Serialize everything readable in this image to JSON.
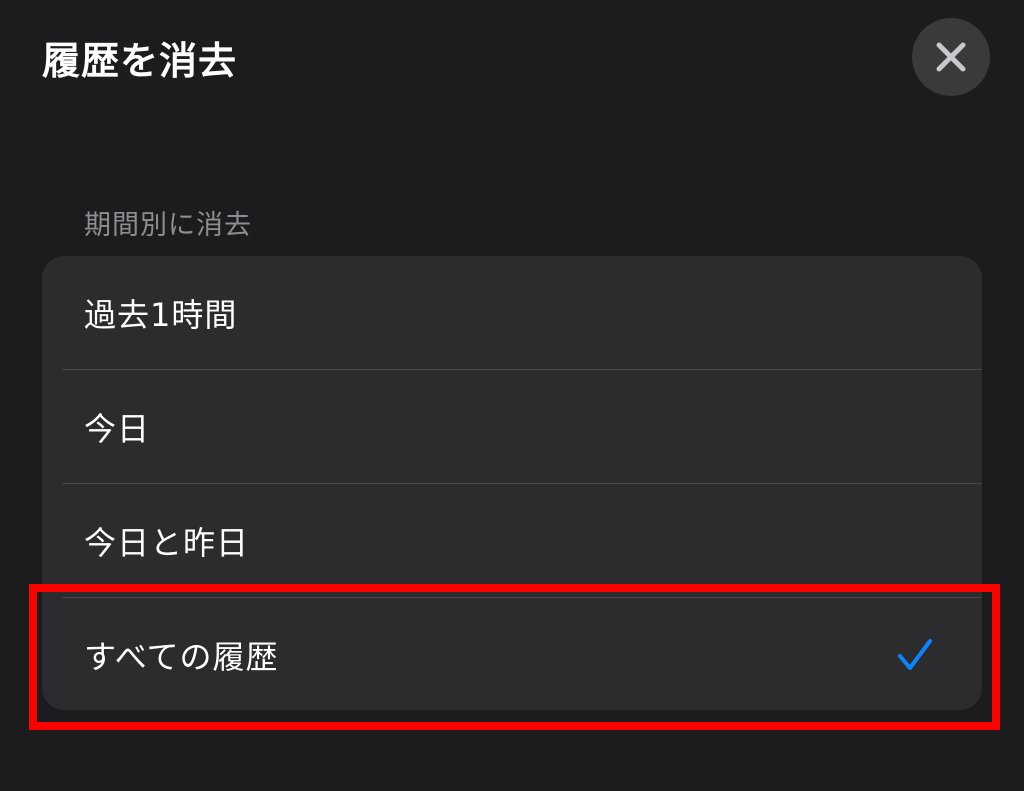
{
  "header": {
    "title": "履歴を消去"
  },
  "section": {
    "header": "期間別に消去",
    "items": [
      {
        "label": "過去1時間",
        "selected": false
      },
      {
        "label": "今日",
        "selected": false
      },
      {
        "label": "今日と昨日",
        "selected": false
      },
      {
        "label": "すべての履歴",
        "selected": true
      }
    ]
  },
  "colors": {
    "background": "#1c1c1e",
    "group_background": "#2c2c2e",
    "accent": "#0a84ff",
    "highlight": "#ff0000"
  },
  "icons": {
    "close": "close-icon",
    "check": "checkmark-icon"
  }
}
